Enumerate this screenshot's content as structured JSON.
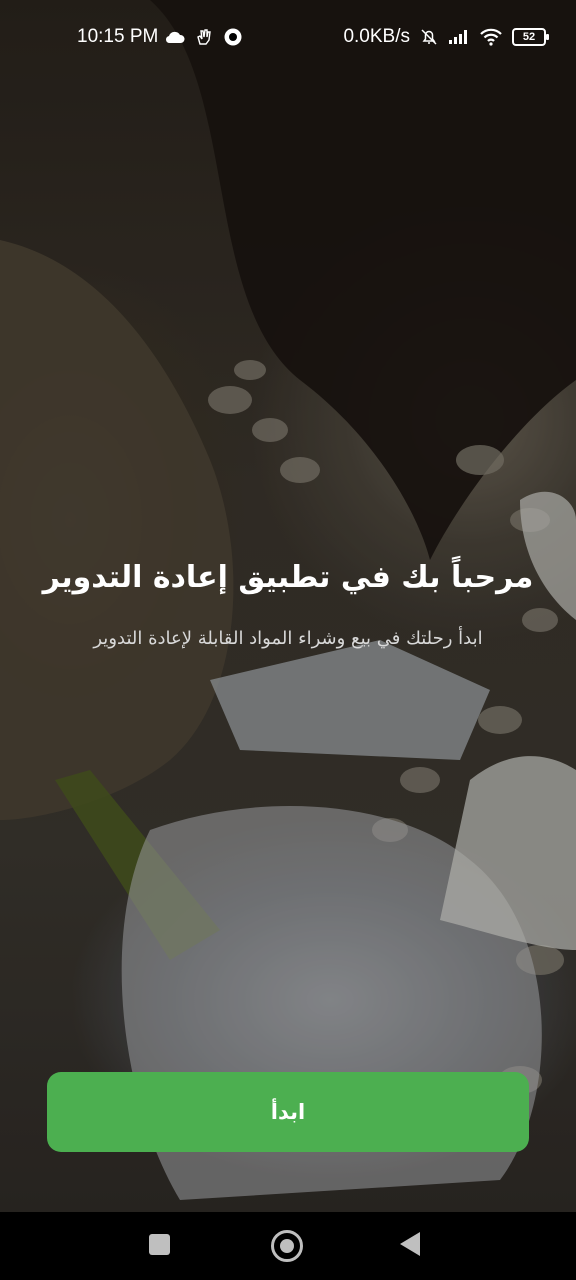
{
  "status_bar": {
    "time": "10:15 PM",
    "network_speed": "0.0KB/s",
    "battery_level": "52",
    "icons": [
      "cloud-icon",
      "hand-icon",
      "app-icon",
      "mute-icon",
      "signal-icon",
      "wifi-icon",
      "battery-icon"
    ]
  },
  "welcome": {
    "title": "مرحباً بك في تطبيق إعادة التدوير",
    "subtitle": "ابدأ رحلتك في بيع وشراء المواد القابلة لإعادة التدوير"
  },
  "start_button": {
    "label": "ابدأ"
  },
  "colors": {
    "accent": "#4caf50",
    "nav_bar": "#000000",
    "text": "#ffffff"
  },
  "nav_bar": {
    "icons": [
      "recent-apps-icon",
      "home-icon",
      "back-icon"
    ]
  }
}
